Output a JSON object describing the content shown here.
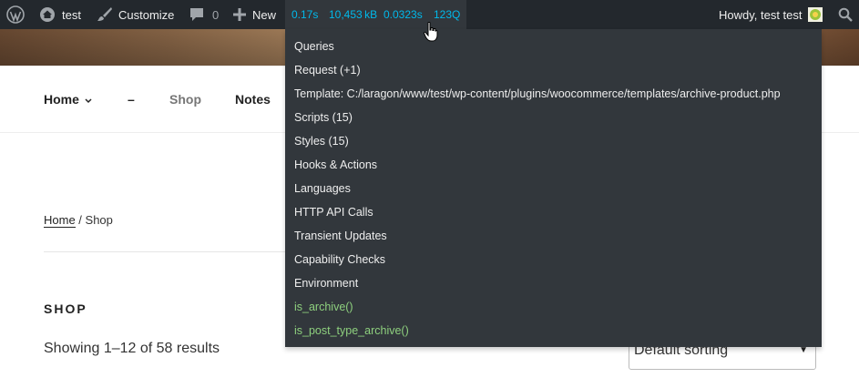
{
  "adminbar": {
    "site_name": "test",
    "customize_label": "Customize",
    "comments_count": "0",
    "new_label": "New",
    "qm_stats": [
      "0.17s",
      "10,453 kB",
      "0.0323s",
      "123Q"
    ],
    "greeting": "Howdy, test test",
    "icons": [
      "wordpress-logo-icon",
      "home-icon",
      "brush-icon",
      "comment-icon",
      "plus-icon",
      "avatar",
      "search-icon"
    ]
  },
  "qm_menu": {
    "items": [
      "Queries",
      "Request (+1)",
      "Template: C:/laragon/www/test/wp-content/plugins/woocommerce/templates/archive-product.php",
      "Scripts (15)",
      "Styles (15)",
      "Hooks & Actions",
      "Languages",
      "HTTP API Calls",
      "Transient Updates",
      "Capability Checks",
      "Environment",
      "is_archive()",
      "is_post_type_archive()"
    ]
  },
  "nav": {
    "home": "Home",
    "dash": "–",
    "shop": "Shop",
    "notes": "Notes"
  },
  "breadcrumb": {
    "home": "Home",
    "separator": " / ",
    "current": "Shop"
  },
  "shop": {
    "title": "SHOP",
    "result_count": "Showing 1–12 of 58 results",
    "sort_selected": "Default sorting"
  },
  "colors": {
    "adminbar_bg": "#23282d",
    "qm_bg": "#32373c",
    "qm_stat": "#00b9eb",
    "qm_conditional": "#8ed07e"
  }
}
